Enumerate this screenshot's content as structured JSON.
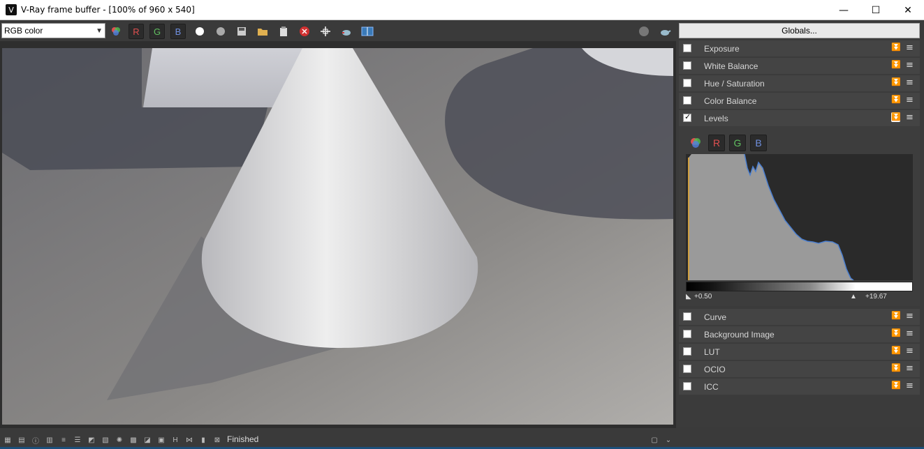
{
  "window": {
    "title": "V-Ray frame buffer - [100% of 960 x 540]",
    "minimize": "—",
    "maximize": "☐",
    "close": "✕"
  },
  "toolbar": {
    "channel_select": "RGB color",
    "channel_r": "R",
    "channel_g": "G",
    "channel_b": "B",
    "globals_label": "Globals..."
  },
  "rollouts": [
    {
      "label": "Exposure",
      "checked": false
    },
    {
      "label": "White Balance",
      "checked": false
    },
    {
      "label": "Hue / Saturation",
      "checked": false
    },
    {
      "label": "Color Balance",
      "checked": false
    },
    {
      "label": "Levels",
      "checked": true
    },
    {
      "label": "Curve",
      "checked": false
    },
    {
      "label": "Background Image",
      "checked": false
    },
    {
      "label": "LUT",
      "checked": false
    },
    {
      "label": "OCIO",
      "checked": false
    },
    {
      "label": "ICC",
      "checked": false
    }
  ],
  "levels": {
    "btn_r": "R",
    "btn_g": "G",
    "btn_b": "B",
    "black_point": "+0.50",
    "white_point": "+19.67"
  },
  "status": {
    "text": "Finished",
    "h_label": "H"
  },
  "colors": {
    "panel_bg": "#3a3a3a",
    "red_channel": "#e04040",
    "green_channel": "#50c050",
    "blue_channel": "#5080e0"
  }
}
